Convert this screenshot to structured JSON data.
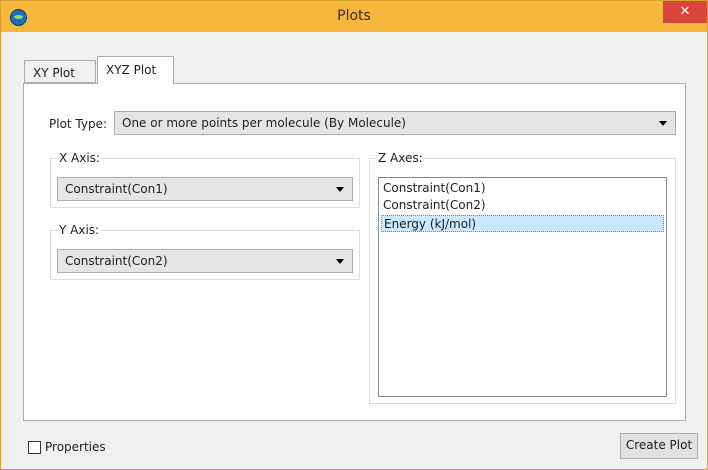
{
  "window": {
    "title": "Plots",
    "close_glyph": "✕"
  },
  "tabs": [
    {
      "label": "XY Plot"
    },
    {
      "label": "XYZ Plot"
    }
  ],
  "plot_type": {
    "label": "Plot Type:",
    "value": "One or more points per molecule (By Molecule)"
  },
  "x_axis": {
    "label": "X Axis:",
    "value": "Constraint(Con1)"
  },
  "y_axis": {
    "label": "Y Axis:",
    "value": "Constraint(Con2)"
  },
  "z_axes": {
    "label": "Z Axes:",
    "items": [
      {
        "label": "Constraint(Con1)"
      },
      {
        "label": "Constraint(Con2)"
      },
      {
        "label": "Energy (kJ/mol)"
      }
    ],
    "selected_index": 2
  },
  "footer": {
    "properties_label": "Properties",
    "properties_checked": false,
    "create_plot_label": "Create Plot"
  },
  "colors": {
    "titlebar": "#f6b73c",
    "close": "#d9443b",
    "selection": "#cce8ff"
  },
  "icons": {
    "app": "app-molecule-icon",
    "close": "close-icon",
    "dropdown": "chevron-down-icon"
  }
}
